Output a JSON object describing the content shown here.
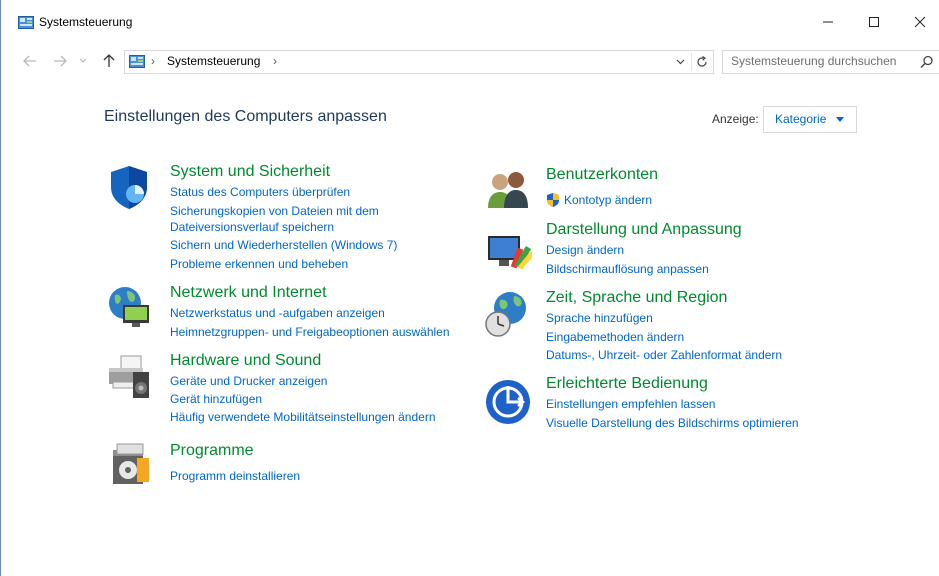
{
  "window": {
    "title": "Systemsteuerung",
    "controls": {
      "minimize": "minimize",
      "maximize": "maximize",
      "close": "close"
    }
  },
  "address": {
    "crumb": "Systemsteuerung",
    "separator": "›",
    "search_placeholder": "Systemsteuerung durchsuchen"
  },
  "main": {
    "title": "Einstellungen des Computers anpassen",
    "view_label": "Anzeige:",
    "view_value": "Kategorie"
  },
  "categories": {
    "system": {
      "title": "System und Sicherheit",
      "icon": "shield-icon",
      "links": [
        "Status des Computers überprüfen",
        "Sicherungskopien von Dateien mit dem",
        "Dateiversionsverlauf speichern",
        "Sichern und Wiederherstellen (Windows 7)",
        "Probleme erkennen und beheben"
      ]
    },
    "network": {
      "title": "Netzwerk und Internet",
      "icon": "network-globe-icon",
      "links": [
        "Netzwerkstatus und -aufgaben anzeigen",
        "Heimnetzgruppen- und Freigabeoptionen auswählen"
      ]
    },
    "hardware": {
      "title": "Hardware und Sound",
      "icon": "printer-speaker-icon",
      "links": [
        "Geräte und Drucker anzeigen",
        "Gerät hinzufügen",
        "Häufig verwendete Mobilitätseinstellungen ändern"
      ]
    },
    "programs": {
      "title": "Programme",
      "icon": "programs-box-icon",
      "links": [
        "Programm deinstallieren"
      ]
    },
    "users": {
      "title": "Benutzerkonten",
      "icon": "users-icon",
      "links": [
        "Kontotyp ändern"
      ]
    },
    "appearance": {
      "title": "Darstellung und Anpassung",
      "icon": "display-paint-icon",
      "links": [
        "Design ändern",
        "Bildschirmauflösung anpassen"
      ]
    },
    "region": {
      "title": "Zeit, Sprache und Region",
      "icon": "globe-clock-icon",
      "links": [
        "Sprache hinzufügen",
        "Eingabemethoden ändern",
        "Datums-, Uhrzeit- oder Zahlenformat ändern"
      ]
    },
    "access": {
      "title": "Erleichterte Bedienung",
      "icon": "ease-of-access-icon",
      "links": [
        "Einstellungen empfehlen lassen",
        "Visuelle Darstellung des Bildschirms optimieren"
      ]
    }
  },
  "colors": {
    "category_title": "#008a2e",
    "link": "#0066cc",
    "page_title": "#1e395b",
    "window_border": "#6d8fb5"
  }
}
